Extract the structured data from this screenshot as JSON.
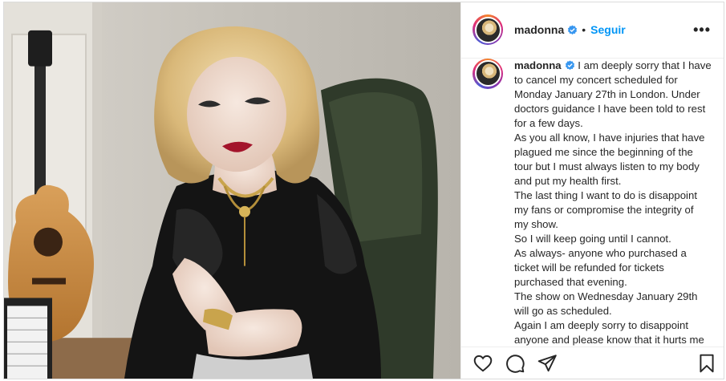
{
  "header": {
    "username": "madonna",
    "separator": "•",
    "follow_label": "Seguir",
    "more_label": "•••"
  },
  "caption": {
    "username": "madonna",
    "lines": [
      "I am deeply sorry that I have",
      "to cancel my concert scheduled for",
      "Monday January 27th in London. Under",
      "doctors guidance I have been told to rest",
      "for a few days.",
      "As you all know, I have injuries that have",
      "plagued me since the beginning of the",
      "tour but I must always listen to my body",
      "and put my health first.",
      "The last thing I want to do is disappoint",
      "my fans or compromise the integrity of",
      "my show.",
      "So I will keep going until I cannot.",
      "As always- anyone who purchased a",
      "ticket will be refunded for tickets",
      "purchased that evening.",
      "The show on Wednesday January 29th",
      "will go as scheduled.",
      "Again I am deeply sorry to disappoint",
      "anyone and please know that it hurts me"
    ]
  },
  "icons": {
    "verified": "verified-badge-icon",
    "like": "heart-icon",
    "comment": "comment-icon",
    "share": "paper-plane-icon",
    "save": "bookmark-icon"
  },
  "colors": {
    "accent": "#0095f6",
    "text": "#262626",
    "border": "#dbdbdb"
  }
}
